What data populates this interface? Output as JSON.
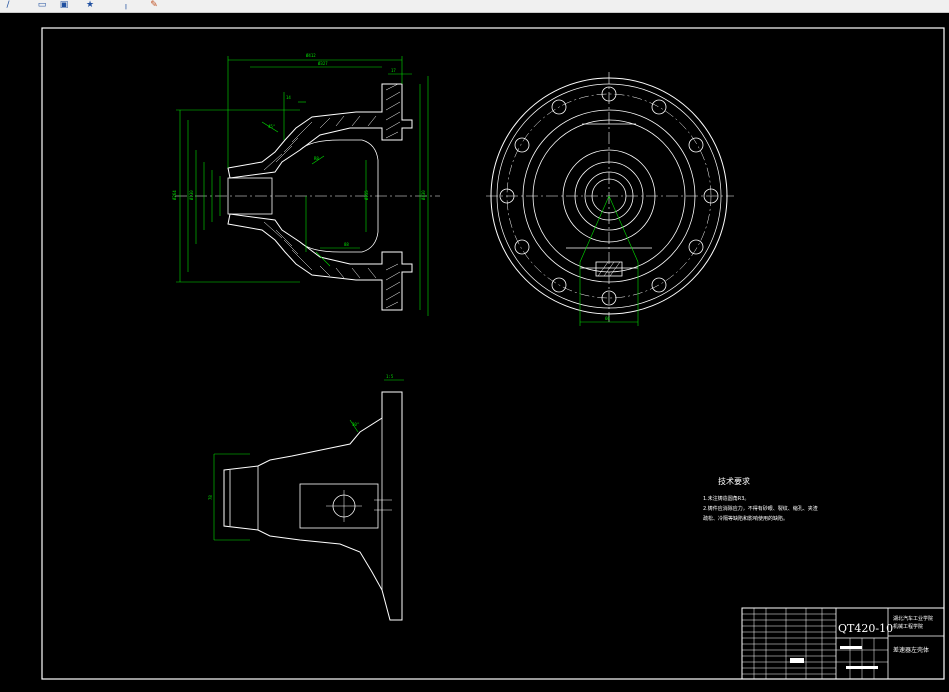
{
  "toolbar": {
    "buttons": [
      {
        "name": "pen-icon",
        "glyph": "/"
      },
      {
        "name": "rectangle-icon",
        "glyph": "▭"
      },
      {
        "name": "save-icon",
        "glyph": "▣"
      },
      {
        "name": "star-icon",
        "glyph": "★"
      },
      {
        "name": "line-icon",
        "glyph": "╷"
      },
      {
        "name": "paint-icon",
        "glyph": "✎"
      }
    ]
  },
  "drawing": {
    "background": "#000000",
    "line_color": "#ffffff",
    "dimension_color": "#00e000",
    "tech_requirements": {
      "title": "技术要求",
      "lines": [
        "1.未注铸造圆角R3。",
        "2.铸件应消除应力，不得有砂眼、裂纹、缩孔、夹渣",
        "  疏松、冷隔等缺陷和影响使用的缺陷。"
      ]
    },
    "title_block": {
      "drawing_number": "QT420-10",
      "school": "湖北汽车工业学院",
      "department": "机械工程学院",
      "part_name": "差速器左壳体"
    }
  }
}
